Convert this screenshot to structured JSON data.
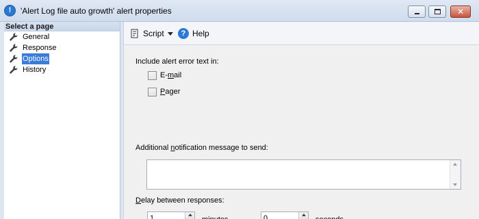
{
  "window": {
    "title": "'Alert Log file auto growth' alert properties",
    "controls": {
      "minimize": "minimize-icon",
      "maximize": "maximize-icon",
      "close": "close-icon"
    }
  },
  "sidebar": {
    "header": "Select a page",
    "items": [
      {
        "label": "General",
        "selected": false,
        "icon": "wrench-icon"
      },
      {
        "label": "Response",
        "selected": false,
        "icon": "wrench-icon"
      },
      {
        "label": "Options",
        "selected": true,
        "icon": "wrench-icon"
      },
      {
        "label": "History",
        "selected": false,
        "icon": "wrench-icon"
      }
    ]
  },
  "toolbar": {
    "script_label": "Script",
    "help_label": "Help"
  },
  "options": {
    "include_label": "Include alert error text in:",
    "email_label_pre": "E-",
    "email_label_u": "m",
    "email_label_post": "ail",
    "email_checked": false,
    "pager_label_u": "P",
    "pager_label_post": "ager",
    "pager_checked": false,
    "notification_label_pre": "Additional ",
    "notification_label_u": "n",
    "notification_label_post": "otification message to send:",
    "notification_value": "",
    "delay_label_u": "D",
    "delay_label_post": "elay between responses:",
    "minutes_value": "1",
    "minutes_label": "minutes",
    "seconds_value": "0",
    "seconds_label_pre": "se",
    "seconds_label_u": "c",
    "seconds_label_post": "onds"
  },
  "colors": {
    "selection": "#3b7cd9",
    "titlebar": "#dfe8f3",
    "close_button": "#c7553f"
  }
}
